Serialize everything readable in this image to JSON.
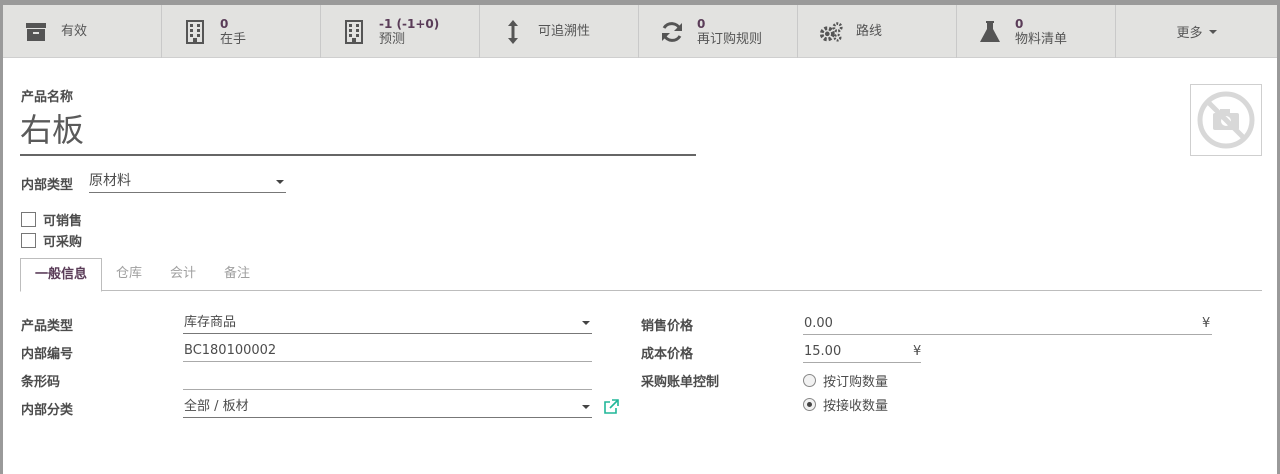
{
  "smart_buttons": [
    {
      "name": "active-button",
      "number": "",
      "label": "有效"
    },
    {
      "name": "on-hand-button",
      "number": "0",
      "label": "在手"
    },
    {
      "name": "forecast-button",
      "number": "-1 (-1+0)",
      "label": "预测"
    },
    {
      "name": "traceability-button",
      "number": "",
      "label": "可追溯性"
    },
    {
      "name": "reorder-rules-button",
      "number": "0",
      "label": "再订购规则"
    },
    {
      "name": "routes-button",
      "number": "",
      "label": "路线"
    },
    {
      "name": "bom-button",
      "number": "0",
      "label": "物料清单"
    },
    {
      "name": "more-button",
      "number": "",
      "label": "更多"
    }
  ],
  "product": {
    "name_label": "产品名称",
    "name": "右板",
    "internal_type_label": "内部类型",
    "internal_type": "原材料",
    "can_be_sold_label": "可销售",
    "can_be_sold": false,
    "can_be_purchased_label": "可采购",
    "can_be_purchased": false
  },
  "tabs": [
    "一般信息",
    "仓库",
    "会计",
    "备注"
  ],
  "general": {
    "product_type_label": "产品类型",
    "product_type": "库存商品",
    "internal_ref_label": "内部编号",
    "internal_ref": "BC180100002",
    "barcode_label": "条形码",
    "barcode": "",
    "category_label": "内部分类",
    "category": "全部 / 板材",
    "sale_price_label": "销售价格",
    "sale_price": "0.00",
    "cost_label": "成本价格",
    "cost": "15.00",
    "currency": "¥",
    "bill_control_label": "采购账单控制",
    "bill_control_options": [
      "按订购数量",
      "按接收数量"
    ],
    "bill_control_selected": 1
  },
  "colors": {
    "accent": "#5a3c58",
    "bar_bg": "#e2e2e0"
  }
}
